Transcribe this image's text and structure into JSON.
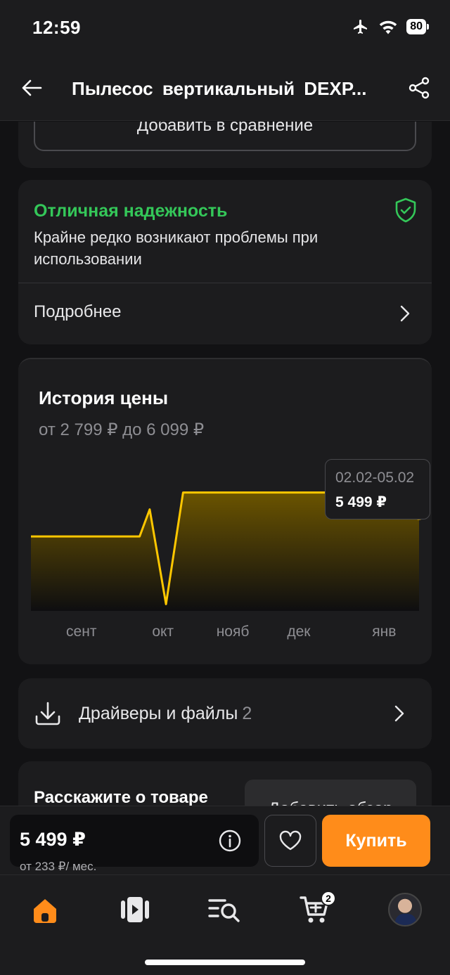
{
  "status_bar": {
    "time": "12:59",
    "battery": "80"
  },
  "nav": {
    "title": "Пылесос  вертикальный  DEXP..."
  },
  "compare": {
    "label": "Добавить в сравнение"
  },
  "reliability": {
    "title": "Отличная надежность",
    "description": "Крайне редко возникают проблемы при использовании",
    "more_label": "Подробнее",
    "accent_color": "#34c759"
  },
  "price_history": {
    "title": "История цены",
    "range": "от 2 799 ₽ до 6 099 ₽",
    "tooltip": {
      "date": "02.02-05.02",
      "price": "5 499 ₽"
    },
    "months": [
      "сент",
      "окт",
      "нояб",
      "дек",
      "янв"
    ]
  },
  "chart_data": {
    "type": "area",
    "title": "История цены",
    "series": [
      {
        "values": [
          4800,
          4800,
          4800,
          4800,
          4800,
          4800,
          5600,
          2799,
          6099,
          6099,
          6099,
          6099,
          6099,
          6099,
          6099,
          6099,
          6099,
          6099,
          6099,
          6099,
          5499,
          5499
        ]
      }
    ],
    "x_positions": [
      0.0,
      0.1,
      0.2,
      0.28,
      0.26,
      0.27,
      0.306,
      0.348,
      0.392,
      0.5,
      0.6,
      0.7,
      0.75,
      0.8,
      0.85,
      0.9,
      0.92,
      0.93,
      0.94,
      0.95,
      0.97,
      1.0
    ],
    "categories": [
      "сент",
      "окт",
      "нояб",
      "дек",
      "янв"
    ],
    "ylim": [
      2600,
      6300
    ],
    "grid": false,
    "line_color": "#ffc700"
  },
  "drivers": {
    "label": "Драйверы и файлы",
    "count": "2"
  },
  "review": {
    "title": "Расскажите о товаре",
    "button": "Добавить обзор"
  },
  "bottom_bar": {
    "price": "5 499 ₽",
    "credit": "от 233 ₽/ мес.",
    "buy_label": "Купить",
    "buy_color": "#ff8c1a"
  },
  "tabs": [
    {
      "name": "home",
      "icon": "home-icon",
      "active": true
    },
    {
      "name": "catalog",
      "icon": "video-catalog-icon"
    },
    {
      "name": "search",
      "icon": "list-search-icon"
    },
    {
      "name": "cart",
      "icon": "cart-icon",
      "badge": "2"
    },
    {
      "name": "profile",
      "icon": "avatar"
    }
  ]
}
